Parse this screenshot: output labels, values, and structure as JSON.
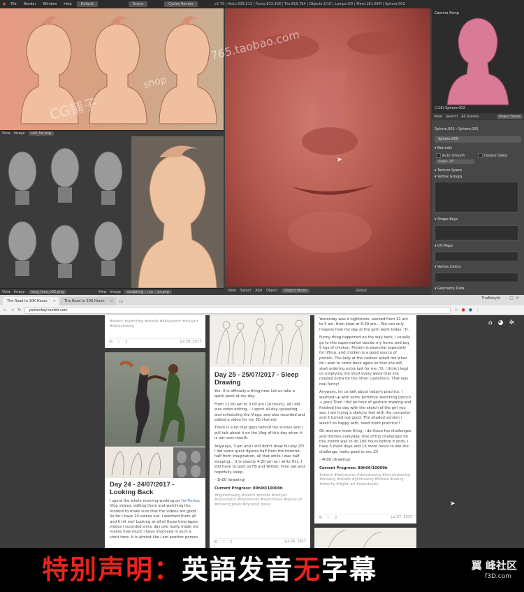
{
  "blender": {
    "menus": [
      "File",
      "Render",
      "Window",
      "Help"
    ],
    "layout": "Default",
    "scene": "Scene",
    "engine": "Cycles Render",
    "stats": "v2.79 | Verts:528,313 | Faces:823,368 | Tris:655,784 | Objects:1/10 | Lamps:0/0 | Mem:181.58M | Sphere.002",
    "ref_header_1": {
      "view": "View",
      "image": "Image",
      "file": "cell_hd.png"
    },
    "ref_header_2": {
      "view": "View",
      "image": "Image",
      "file": "long_face_v02.png"
    },
    "ref_header_3": {
      "view": "View",
      "image": "Image",
      "file": "sculpting ... yu ...ys.png"
    },
    "viewport_header": {
      "view": "View",
      "select": "Select",
      "add": "Add",
      "object": "Object",
      "mode": "Object Mode",
      "orient": "Global"
    },
    "camera": {
      "label": "Camera Persp",
      "object": "(118) Sphere.002"
    },
    "props_header": {
      "view": "View",
      "search": "Search",
      "all": "All Scenes",
      "mode": "Object Mode"
    },
    "breadcrumb": {
      "a": "Sphere.002",
      "b": "Sphere.005"
    },
    "mesh_name": "Sphere.005",
    "panels": {
      "normals": "Normals",
      "auto_smooth": "Auto Smooth",
      "double_sided": "Double Sided",
      "angle": "Angle:",
      "angle_val": "30°",
      "texture_space": "Texture Space",
      "vertex_groups": "Vertex Groups",
      "shape_keys": "Shape Keys",
      "uv_maps": "UV Maps",
      "vertex_colors": "Vertex Colors",
      "geometry_data": "Geometry Data"
    }
  },
  "watermark": {
    "shop": "shop",
    "shop_url": "765.taobao.com",
    "brand": "CG铺子"
  },
  "browser": {
    "tabs": [
      {
        "title": "The Road to 10K Hours"
      },
      {
        "title": "The Road to 10K Hours"
      }
    ],
    "user": "TheBabyfd",
    "url": "yantenkay.tumblr.com"
  },
  "posts": {
    "col1_top": {
      "tags": "#sketch #sketching #doodle #dailysketch #dailyart #dailydrawing",
      "date": "Jul 28, 2017"
    },
    "col1_main": {
      "title": "Day 24 - 24/07/2017 - Looking Back",
      "p1_pre": "I spent the whole morning working on ",
      "p1_link": "YanTenkay",
      "p1_post": " Vlog videos, editing them and watching the renders to make sure that the videos are good. So far i have 20 videos out. I watched them all and it hit me! Looking at all of these time-lapse videos i recorded since day one really made me realize how much i have improved in such a short time. It is almost like i am another person."
    },
    "col2": {
      "title": "Day 25 - 25/07/2017 - Sleep Drawing",
      "p1": "Yes. It is officially a thing now. Let us take a quick peek at my day.",
      "p2": "From 11:00 am to 3:00 am (16 hours), all i did was video editing... I spent all day uploading and scheduling the Vlogs, and also recorded and edited a video for my 3D channel.",
      "p3": "There is a lot that goes behind the scenes and i will talk about it on the Vlog of this day when it is out next month.",
      "p4": "Anyways, 3 am and i still didn't draw for day 25! I did some quick figures half from the internet, half from imagination, all that while i was half sleeping... It is exactly 4:20 am as i write this. I still have to post on FB and Twitter, then eat and hopefully sleep.",
      "p5": "- 1h00 (drawing)",
      "progress": "Current Progress: 89h00/10000h",
      "tags": "#figuredrawing #sketch #doodle #dailyart #dailysketch #dailydoodle #sketchbook #digital art #drawing poses #dynamic poses",
      "date": "Jul 26, 2017"
    },
    "col3": {
      "p1": "Yesterday was a nightmare, worked from 11 am to 4 am, then slept at 5:30 am... You can only imagine how my day at the gym went today :'D.",
      "p2": "Funny thing happened on the way back, i usually go to this supermarket beside my home and buy 5 kgs of chicken. Protein is essential especially for lifting, and chicken is a good source of protein. The lady at the cashier asked me when do i plan to come back again so that she will start ordering extra just for me :'D. I think i kept on emptying the shelf every week that she needed extra for the other customers. That was real funny!",
      "p3": "Anyways, let us talk about today's practice. I warmed up with some primitive sketching (pencil + pen) Then i did an hour of gesture drawing and finished the day with the sketch of the girl you see. I am trying a sketchy feel with the computer and it turned out good. The shaded version i wasn't so happy with, need more practice!!",
      "p4": "Oh and one more thing, i do these fun challenges and themes everyday. One of the challenges for this month was to do 100 hours before it ends. I have 5 more days and 15 more hours to win the challenge, looks good to me :D!",
      "p5": "- 4h00 (drawing)",
      "progress": "Current Progress: 89h00/10000h",
      "tags": "#sketch #dailysketch #dailydrawing #femaledrawing #drawing #doodle #girldrawing #female drawing #sketchy #digital art #dailydoodle",
      "date": "Jul 27, 2017"
    }
  },
  "banner": {
    "part1": "特别声明：",
    "part2": "英語发音",
    "part3": "无",
    "part4": "字幕",
    "logo": "翼 峰社区",
    "site": "f3D.com"
  },
  "colors": {
    "banner_red": "#e8231e",
    "sculpt_red": "#b65a50",
    "clay": "#e6b08c"
  }
}
